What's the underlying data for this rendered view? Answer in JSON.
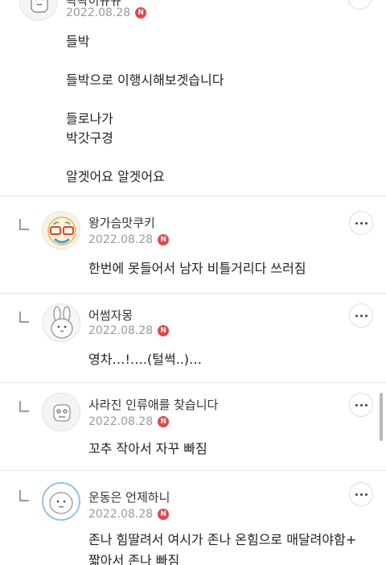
{
  "comments": [
    {
      "nickname": "꽉꽉이뀨뀨",
      "date": "2022.08.28",
      "badge": "N",
      "is_reply": false,
      "lines": [
        "들박",
        "들박으로 이행시해보겟습니다",
        "들로나가",
        "박갓구경",
        "알겟어요 알겟어요"
      ]
    },
    {
      "nickname": "왕가슴맛쿠키",
      "date": "2022.08.28",
      "badge": "N",
      "is_reply": true,
      "lines": [
        "한번에 못들어서 남자 비틀거리다 쓰러짐"
      ]
    },
    {
      "nickname": "어썸자몽",
      "date": "2022.08.28",
      "badge": "N",
      "is_reply": true,
      "lines": [
        "영차…!….(털썩..)…"
      ]
    },
    {
      "nickname": "사라진 인류애를 찾습니다",
      "date": "2022.08.28",
      "badge": "N",
      "is_reply": true,
      "lines": [
        "꼬추 작아서 자꾸 빠짐"
      ]
    },
    {
      "nickname": "운동은 언제하니",
      "date": "2022.08.28",
      "badge": "N",
      "is_reply": true,
      "lines": [
        "존나 힘딸려서 여시가 존나 온힘으로 매달려야함+",
        "짧아서 존나 빠짐"
      ]
    }
  ],
  "icons": {
    "more": "more-horizontal-icon",
    "reply": "reply-arrow-icon",
    "new_badge": "new-badge"
  },
  "colors": {
    "badge": "#e0474c",
    "meta_text": "#9a9a9a",
    "divider": "#e8e8e8"
  }
}
